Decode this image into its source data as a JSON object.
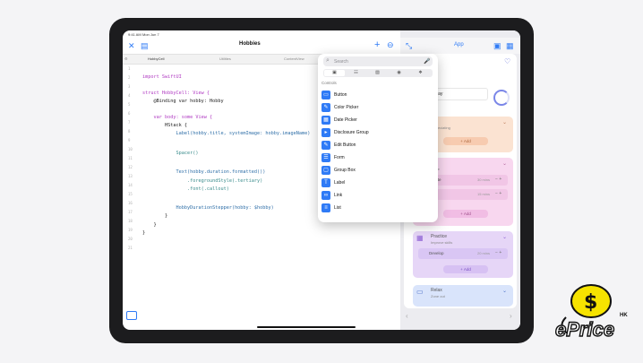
{
  "status_bar": {
    "time": "9:41 AM",
    "date": "Mon Jun 7",
    "battery": "100%"
  },
  "editor": {
    "title": "Hobbies",
    "tabs": [
      "HobbyCell",
      "Utilities",
      "ContentView"
    ],
    "lines": [
      "",
      "import SwiftUI",
      "",
      "struct HobbyCell: View {",
      "    @Binding var hobby: Hobby",
      "",
      "    var body: some View {",
      "        HStack {",
      "            Label(hobby.title, systemImage: hobby.imageName)",
      "",
      "            Spacer()",
      "",
      "            Text(hobby.duration.formatted())",
      "                .foregroundStyle(.tertiary)",
      "                .font(.callout)",
      "",
      "            HobbyDurationStepper(hobby: $hobby)",
      "        }",
      "    }",
      "}"
    ]
  },
  "preview": {
    "title": "App",
    "banner_text": "beautiful day",
    "banner_sub": "ns total",
    "cards": [
      {
        "title": "ile",
        "sub": "appreciating",
        "add": "Add",
        "color": "#fbe3d2",
        "btn": "#f7cbb0"
      },
      {
        "title": "de",
        "sub": "guide",
        "add": "Add",
        "color": "#f8d7ef",
        "btn": "#f1bde4"
      },
      {
        "title": "Practice",
        "sub": "Improve skills",
        "add": "Add",
        "color": "#e6d6f7",
        "btn": "#d7c1f3"
      },
      {
        "title": "Relax",
        "sub": "Zone out",
        "add": "",
        "color": "#d9e4fb",
        "btn": "#c7d6fa"
      }
    ],
    "subrows": [
      {
        "label": "Create",
        "mins": "30 mins"
      },
      {
        "label": "Develop",
        "mins": "20 mins"
      }
    ],
    "subrow_extra_mins": "15 mins",
    "stepper_minus": "−",
    "stepper_plus": "+"
  },
  "popover": {
    "search_placeholder": "Search",
    "section_title": "Controls",
    "items": [
      "Button",
      "Color Picker",
      "Date Picker",
      "Disclosure Group",
      "Edit Button",
      "Form",
      "Group Box",
      "Label",
      "Link",
      "List"
    ]
  },
  "watermark": {
    "brand": "ePrice",
    "region": "HK"
  },
  "colors": {
    "accent": "#2f7bf6"
  }
}
